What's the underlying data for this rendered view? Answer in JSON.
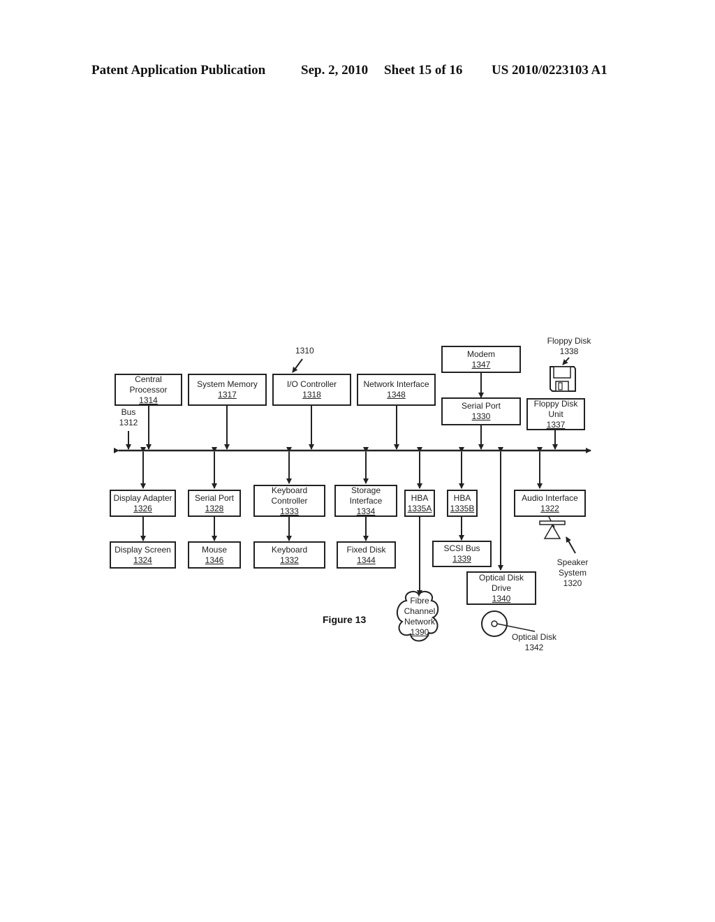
{
  "header": {
    "publication": "Patent Application Publication",
    "date": "Sep. 2, 2010",
    "sheet": "Sheet 15 of 16",
    "number": "US 2010/0223103 A1"
  },
  "figure_label": "Figure 13",
  "system_ref": "1310",
  "bus": {
    "label": "Bus",
    "ref": "1312"
  },
  "top_row": {
    "central_processor": {
      "label": "Central Processor",
      "ref": "1314"
    },
    "system_memory": {
      "label": "System Memory",
      "ref": "1317"
    },
    "io_controller": {
      "label": "I/O Controller",
      "ref": "1318"
    },
    "network_interface": {
      "label": "Network Interface",
      "ref": "1348"
    },
    "modem": {
      "label": "Modem",
      "ref": "1347"
    },
    "serial_port_top": {
      "label": "Serial Port",
      "ref": "1330"
    },
    "floppy_disk_unit": {
      "label": "Floppy Disk Unit",
      "ref": "1337"
    },
    "floppy_disk": {
      "label": "Floppy Disk",
      "ref": "1338"
    }
  },
  "bottom_row": {
    "display_adapter": {
      "label": "Display Adapter",
      "ref": "1326"
    },
    "display_screen": {
      "label": "Display Screen",
      "ref": "1324"
    },
    "serial_port_bottom": {
      "label": "Serial Port",
      "ref": "1328"
    },
    "mouse": {
      "label": "Mouse",
      "ref": "1346"
    },
    "keyboard_controller": {
      "label": "Keyboard Controller",
      "ref": "1333"
    },
    "keyboard": {
      "label": "Keyboard",
      "ref": "1332"
    },
    "storage_interface": {
      "label": "Storage Interface",
      "ref": "1334"
    },
    "fixed_disk": {
      "label": "Fixed Disk",
      "ref": "1344"
    },
    "hba_a": {
      "label": "HBA",
      "ref": "1335A"
    },
    "hba_b": {
      "label": "HBA",
      "ref": "1335B"
    },
    "scsi_bus": {
      "label": "SCSI Bus",
      "ref": "1339"
    },
    "optical_disk_drive": {
      "label": "Optical Disk Drive",
      "ref": "1340"
    },
    "optical_disk": {
      "label": "Optical Disk",
      "ref": "1342"
    },
    "audio_interface": {
      "label": "Audio Interface",
      "ref": "1322"
    },
    "speaker_system": {
      "label": "Speaker System",
      "ref": "1320"
    },
    "fibre_channel_network": {
      "label": "Fibre Channel Network",
      "ref": "1390"
    }
  }
}
